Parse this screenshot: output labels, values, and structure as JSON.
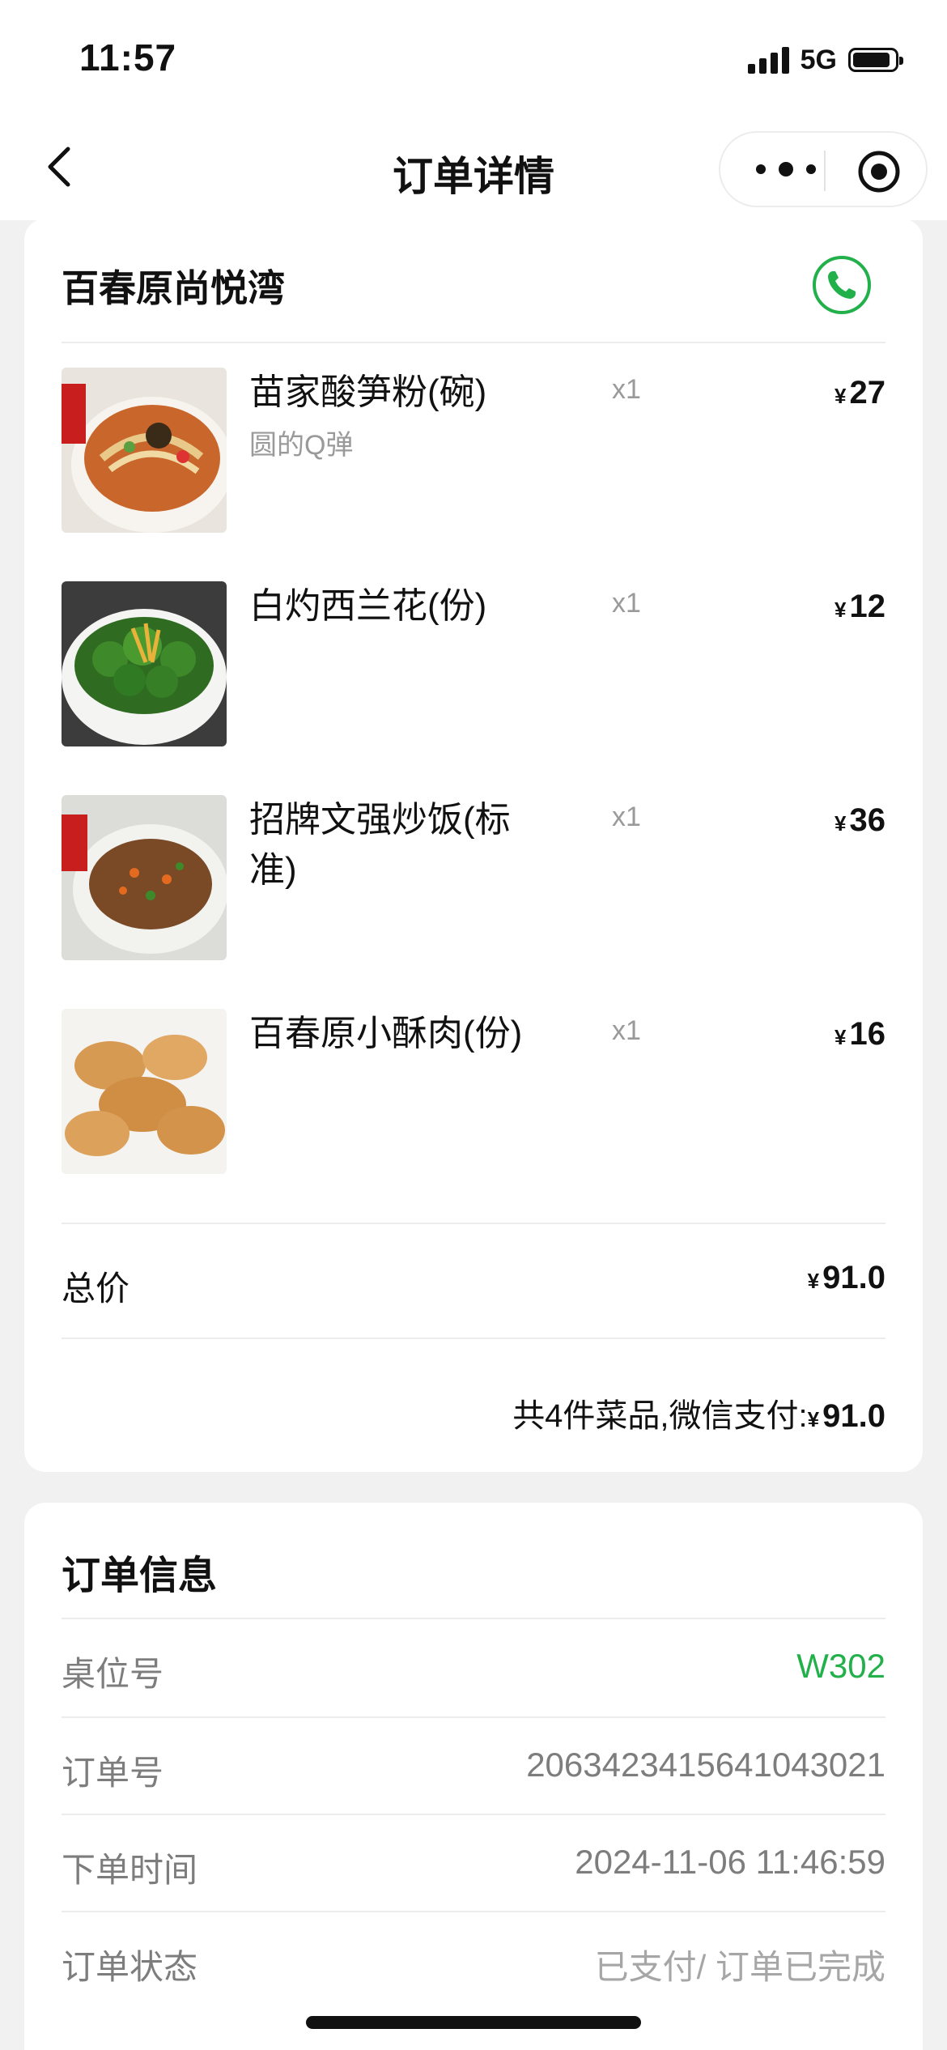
{
  "status_bar": {
    "time": "11:57",
    "network": "5G"
  },
  "nav": {
    "title": "订单详情"
  },
  "store": {
    "name": "百春原尚悦湾"
  },
  "items": [
    {
      "name": "苗家酸笋粉(碗)",
      "sub": "圆的Q弹",
      "qty": "x1",
      "currency": "¥",
      "price": "27"
    },
    {
      "name": "白灼西兰花(份)",
      "sub": "",
      "qty": "x1",
      "currency": "¥",
      "price": "12"
    },
    {
      "name": "招牌文强炒饭(标准)",
      "sub": "",
      "qty": "x1",
      "currency": "¥",
      "price": "36"
    },
    {
      "name": "百春原小酥肉(份)",
      "sub": "",
      "qty": "x1",
      "currency": "¥",
      "price": "16"
    }
  ],
  "total": {
    "label": "总价",
    "currency": "¥",
    "value": "91.0"
  },
  "summary": {
    "text": "共4件菜品,微信支付:",
    "currency": "¥",
    "amount": "91.0"
  },
  "order_info": {
    "title": "订单信息",
    "rows": [
      {
        "label": "桌位号",
        "value": "W302"
      },
      {
        "label": "订单号",
        "value": "2063423415641043021"
      },
      {
        "label": "下单时间",
        "value": "2024-11-06 11:46:59"
      },
      {
        "label": "订单状态",
        "value": "已支付/ 订单已完成"
      }
    ]
  },
  "colors": {
    "accent_green": "#22b04b",
    "page_bg": "#f1f1f1"
  }
}
